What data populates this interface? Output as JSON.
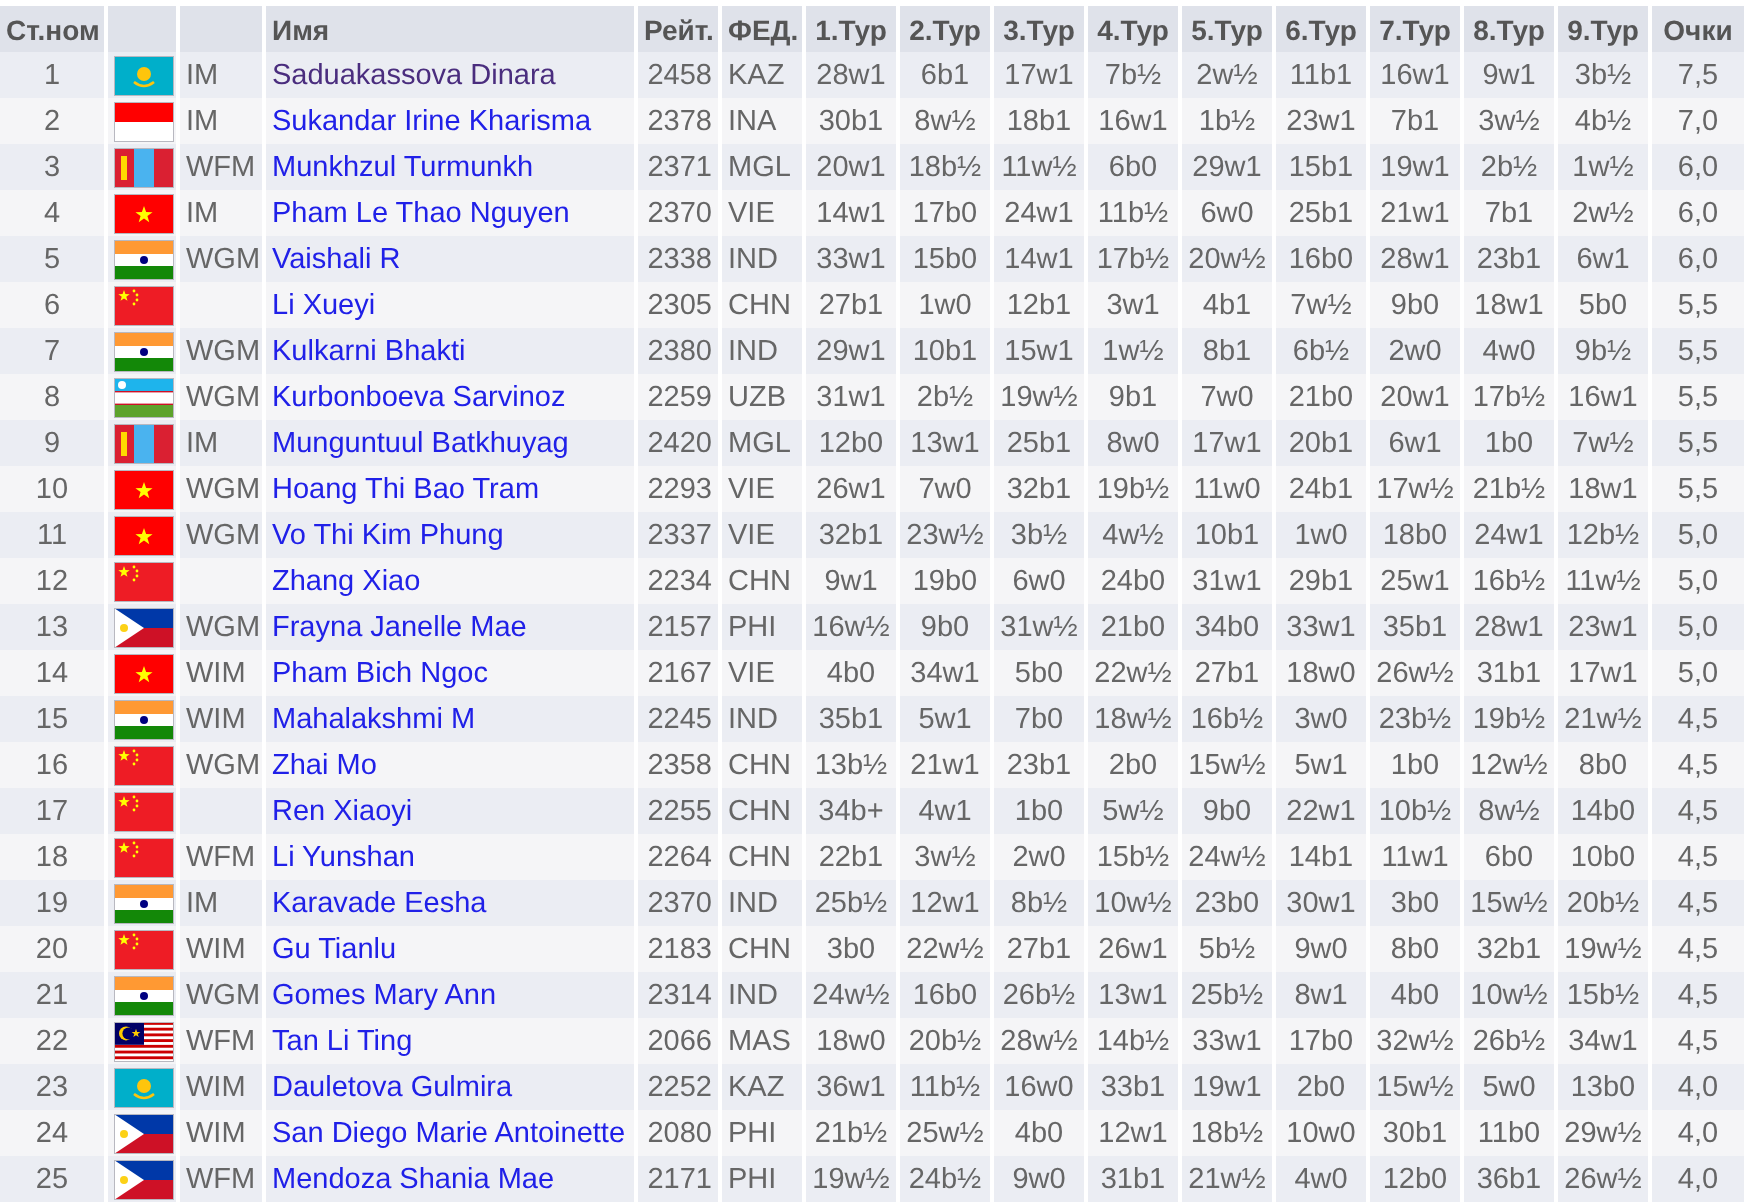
{
  "table": {
    "columns": [
      "Ст.ном",
      "",
      "",
      "Имя",
      "Рейт.",
      "ФЕД.",
      "1.Тур",
      "2.Тур",
      "3.Тур",
      "4.Тур",
      "5.Тур",
      "6.Тур",
      "7.Тур",
      "8.Тур",
      "9.Тур",
      "Очки"
    ],
    "rows": [
      {
        "no": "1",
        "flag": {
          "kind": "kazakhstan"
        },
        "title": "IM",
        "name": "Saduakassova Dinara",
        "visited": true,
        "rating": "2458",
        "fed": "KAZ",
        "rounds": [
          "28w1",
          "6b1",
          "17w1",
          "7b½",
          "2w½",
          "11b1",
          "16w1",
          "9w1",
          "3b½"
        ],
        "points": "7,5"
      },
      {
        "no": "2",
        "flag": {
          "kind": "indonesia"
        },
        "title": "IM",
        "name": "Sukandar Irine Kharisma",
        "visited": false,
        "rating": "2378",
        "fed": "INA",
        "rounds": [
          "30b1",
          "8w½",
          "18b1",
          "16w1",
          "1b½",
          "23w1",
          "7b1",
          "3w½",
          "4b½"
        ],
        "points": "7,0"
      },
      {
        "no": "3",
        "flag": {
          "kind": "mongolia"
        },
        "title": "WFM",
        "name": "Munkhzul Turmunkh",
        "visited": false,
        "rating": "2371",
        "fed": "MGL",
        "rounds": [
          "20w1",
          "18b½",
          "11w½",
          "6b0",
          "29w1",
          "15b1",
          "19w1",
          "2b½",
          "1w½"
        ],
        "points": "6,0"
      },
      {
        "no": "4",
        "flag": {
          "kind": "vietnam"
        },
        "title": "IM",
        "name": "Pham Le Thao Nguyen",
        "visited": false,
        "rating": "2370",
        "fed": "VIE",
        "rounds": [
          "14w1",
          "17b0",
          "24w1",
          "11b½",
          "6w0",
          "25b1",
          "21w1",
          "7b1",
          "2w½"
        ],
        "points": "6,0"
      },
      {
        "no": "5",
        "flag": {
          "kind": "india"
        },
        "title": "WGM",
        "name": "Vaishali R",
        "visited": false,
        "rating": "2338",
        "fed": "IND",
        "rounds": [
          "33w1",
          "15b0",
          "14w1",
          "17b½",
          "20w½",
          "16b0",
          "28w1",
          "23b1",
          "6w1"
        ],
        "points": "6,0"
      },
      {
        "no": "6",
        "flag": {
          "kind": "china"
        },
        "name": "Li Xueyi",
        "visited": false,
        "rating": "2305",
        "fed": "CHN",
        "rounds": [
          "27b1",
          "1w0",
          "12b1",
          "3w1",
          "4b1",
          "7w½",
          "9b0",
          "18w1",
          "5b0"
        ],
        "points": "5,5"
      },
      {
        "no": "7",
        "flag": {
          "kind": "india"
        },
        "title": "WGM",
        "name": "Kulkarni Bhakti",
        "visited": false,
        "rating": "2380",
        "fed": "IND",
        "rounds": [
          "29w1",
          "10b1",
          "15w1",
          "1w½",
          "8b1",
          "6b½",
          "2w0",
          "4w0",
          "9b½"
        ],
        "points": "5,5"
      },
      {
        "no": "8",
        "flag": {
          "kind": "uzbekistan"
        },
        "title": "WGM",
        "name": "Kurbonboeva Sarvinoz",
        "visited": false,
        "rating": "2259",
        "fed": "UZB",
        "rounds": [
          "31w1",
          "2b½",
          "19w½",
          "9b1",
          "7w0",
          "21b0",
          "20w1",
          "17b½",
          "16w1"
        ],
        "points": "5,5"
      },
      {
        "no": "9",
        "flag": {
          "kind": "mongolia"
        },
        "title": "IM",
        "name": "Munguntuul Batkhuyag",
        "visited": false,
        "rating": "2420",
        "fed": "MGL",
        "rounds": [
          "12b0",
          "13w1",
          "25b1",
          "8w0",
          "17w1",
          "20b1",
          "6w1",
          "1b0",
          "7w½"
        ],
        "points": "5,5"
      },
      {
        "no": "10",
        "flag": {
          "kind": "vietnam"
        },
        "title": "WGM",
        "name": "Hoang Thi Bao Tram",
        "visited": false,
        "rating": "2293",
        "fed": "VIE",
        "rounds": [
          "26w1",
          "7w0",
          "32b1",
          "19b½",
          "11w0",
          "24b1",
          "17w½",
          "21b½",
          "18w1"
        ],
        "points": "5,5"
      },
      {
        "no": "11",
        "flag": {
          "kind": "vietnam"
        },
        "title": "WGM",
        "name": "Vo Thi Kim Phung",
        "visited": false,
        "rating": "2337",
        "fed": "VIE",
        "rounds": [
          "32b1",
          "23w½",
          "3b½",
          "4w½",
          "10b1",
          "1w0",
          "18b0",
          "24w1",
          "12b½"
        ],
        "points": "5,0"
      },
      {
        "no": "12",
        "flag": {
          "kind": "china"
        },
        "name": "Zhang Xiao",
        "visited": false,
        "rating": "2234",
        "fed": "CHN",
        "rounds": [
          "9w1",
          "19b0",
          "6w0",
          "24b0",
          "31w1",
          "29b1",
          "25w1",
          "16b½",
          "11w½"
        ],
        "points": "5,0"
      },
      {
        "no": "13",
        "flag": {
          "kind": "philippines"
        },
        "title": "WGM",
        "name": "Frayna Janelle Mae",
        "visited": false,
        "rating": "2157",
        "fed": "PHI",
        "rounds": [
          "16w½",
          "9b0",
          "31w½",
          "21b0",
          "34b0",
          "33w1",
          "35b1",
          "28w1",
          "23w1"
        ],
        "points": "5,0"
      },
      {
        "no": "14",
        "flag": {
          "kind": "vietnam"
        },
        "title": "WIM",
        "name": "Pham Bich Ngoc",
        "visited": false,
        "rating": "2167",
        "fed": "VIE",
        "rounds": [
          "4b0",
          "34w1",
          "5b0",
          "22w½",
          "27b1",
          "18w0",
          "26w½",
          "31b1",
          "17w1"
        ],
        "points": "5,0"
      },
      {
        "no": "15",
        "flag": {
          "kind": "india"
        },
        "title": "WIM",
        "name": "Mahalakshmi M",
        "visited": false,
        "rating": "2245",
        "fed": "IND",
        "rounds": [
          "35b1",
          "5w1",
          "7b0",
          "18w½",
          "16b½",
          "3w0",
          "23b½",
          "19b½",
          "21w½"
        ],
        "points": "4,5"
      },
      {
        "no": "16",
        "flag": {
          "kind": "china"
        },
        "title": "WGM",
        "name": "Zhai Mo",
        "visited": false,
        "rating": "2358",
        "fed": "CHN",
        "rounds": [
          "13b½",
          "21w1",
          "23b1",
          "2b0",
          "15w½",
          "5w1",
          "1b0",
          "12w½",
          "8b0"
        ],
        "points": "4,5"
      },
      {
        "no": "17",
        "flag": {
          "kind": "china"
        },
        "name": "Ren Xiaoyi",
        "visited": false,
        "rating": "2255",
        "fed": "CHN",
        "rounds": [
          "34b+",
          "4w1",
          "1b0",
          "5w½",
          "9b0",
          "22w1",
          "10b½",
          "8w½",
          "14b0"
        ],
        "points": "4,5"
      },
      {
        "no": "18",
        "flag": {
          "kind": "china"
        },
        "title": "WFM",
        "name": "Li Yunshan",
        "visited": false,
        "rating": "2264",
        "fed": "CHN",
        "rounds": [
          "22b1",
          "3w½",
          "2w0",
          "15b½",
          "24w½",
          "14b1",
          "11w1",
          "6b0",
          "10b0"
        ],
        "points": "4,5"
      },
      {
        "no": "19",
        "flag": {
          "kind": "india"
        },
        "title": "IM",
        "name": "Karavade Eesha",
        "visited": false,
        "rating": "2370",
        "fed": "IND",
        "rounds": [
          "25b½",
          "12w1",
          "8b½",
          "10w½",
          "23b0",
          "30w1",
          "3b0",
          "15w½",
          "20b½"
        ],
        "points": "4,5"
      },
      {
        "no": "20",
        "flag": {
          "kind": "china"
        },
        "title": "WIM",
        "name": "Gu Tianlu",
        "visited": false,
        "rating": "2183",
        "fed": "CHN",
        "rounds": [
          "3b0",
          "22w½",
          "27b1",
          "26w1",
          "5b½",
          "9w0",
          "8b0",
          "32b1",
          "19w½"
        ],
        "points": "4,5"
      },
      {
        "no": "21",
        "flag": {
          "kind": "india"
        },
        "title": "WGM",
        "name": "Gomes Mary Ann",
        "visited": false,
        "rating": "2314",
        "fed": "IND",
        "rounds": [
          "24w½",
          "16b0",
          "26b½",
          "13w1",
          "25b½",
          "8w1",
          "4b0",
          "10w½",
          "15b½"
        ],
        "points": "4,5"
      },
      {
        "no": "22",
        "flag": {
          "kind": "malaysia"
        },
        "title": "WFM",
        "name": "Tan Li Ting",
        "visited": false,
        "rating": "2066",
        "fed": "MAS",
        "rounds": [
          "18w0",
          "20b½",
          "28w½",
          "14b½",
          "33w1",
          "17b0",
          "32w½",
          "26b½",
          "34w1"
        ],
        "points": "4,5"
      },
      {
        "no": "23",
        "flag": {
          "kind": "kazakhstan"
        },
        "title": "WIM",
        "name": "Dauletova Gulmira",
        "visited": false,
        "rating": "2252",
        "fed": "KAZ",
        "rounds": [
          "36w1",
          "11b½",
          "16w0",
          "33b1",
          "19w1",
          "2b0",
          "15w½",
          "5w0",
          "13b0"
        ],
        "points": "4,0"
      },
      {
        "no": "24",
        "flag": {
          "kind": "philippines"
        },
        "title": "WIM",
        "name": "San Diego Marie Antoinette",
        "visited": false,
        "rating": "2080",
        "fed": "PHI",
        "rounds": [
          "21b½",
          "25w½",
          "4b0",
          "12w1",
          "18b½",
          "10w0",
          "30b1",
          "11b0",
          "29w½"
        ],
        "points": "4,0"
      },
      {
        "no": "25",
        "flag": {
          "kind": "philippines"
        },
        "title": "WFM",
        "name": "Mendoza Shania Mae",
        "visited": false,
        "rating": "2171",
        "fed": "PHI",
        "rounds": [
          "19w½",
          "24b½",
          "9w0",
          "31b1",
          "21w½",
          "4w0",
          "12b0",
          "36b1",
          "26w½"
        ],
        "points": "4,0"
      }
    ]
  }
}
